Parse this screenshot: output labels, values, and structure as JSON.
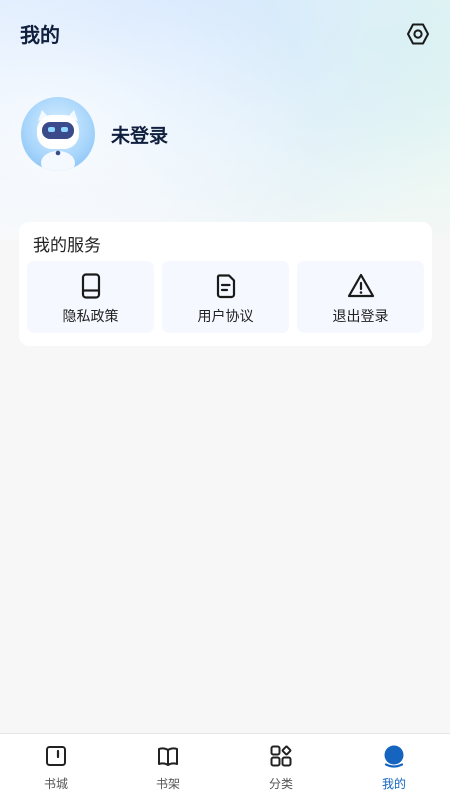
{
  "header": {
    "title": "我的",
    "settings_icon": "settings-hexagon-icon"
  },
  "profile": {
    "avatar": "robot-avatar",
    "status": "未登录"
  },
  "services": {
    "title": "我的服务",
    "items": [
      {
        "label": "隐私政策",
        "icon": "tablet-icon"
      },
      {
        "label": "用户协议",
        "icon": "document-icon"
      },
      {
        "label": "退出登录",
        "icon": "warning-icon"
      }
    ]
  },
  "tabbar": {
    "active_color": "#1565c0",
    "items": [
      {
        "label": "书城",
        "icon": "bookstore-icon",
        "active": false
      },
      {
        "label": "书架",
        "icon": "bookshelf-icon",
        "active": false
      },
      {
        "label": "分类",
        "icon": "category-icon",
        "active": false
      },
      {
        "label": "我的",
        "icon": "profile-icon",
        "active": true
      }
    ]
  }
}
